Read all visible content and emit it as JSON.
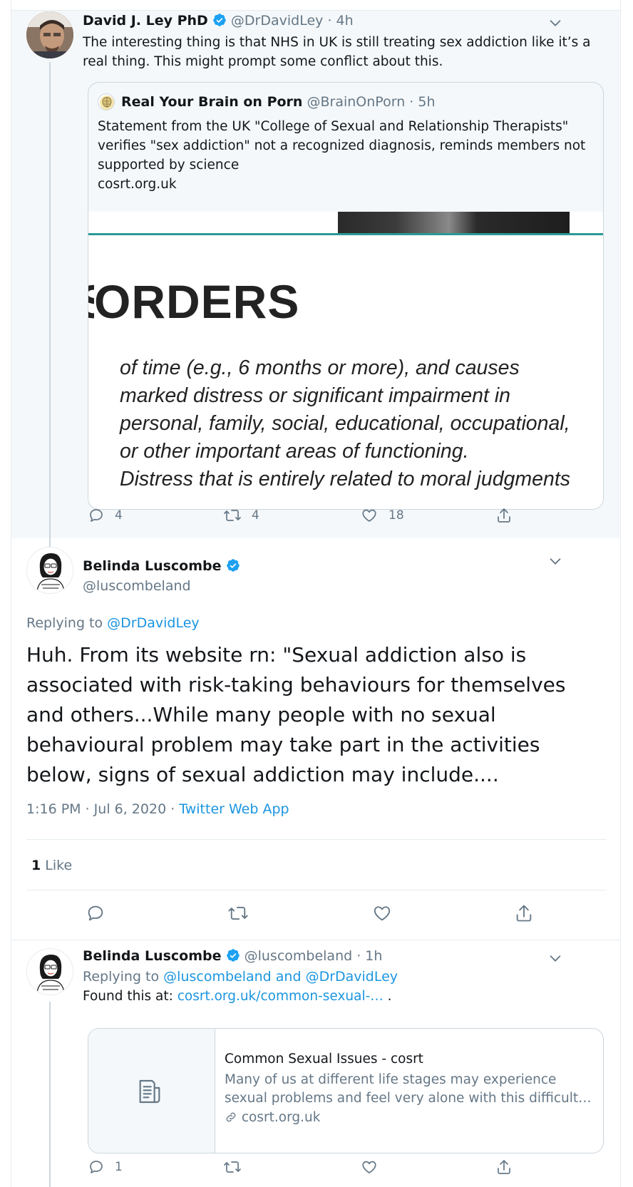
{
  "tweet1": {
    "author": "David J. Ley PhD",
    "handle": "@DrDavidLey",
    "time": "· 4h",
    "text": "The interesting thing is that NHS in UK is still treating sex addiction like it’s a real thing. This might prompt some conflict about this.",
    "quote": {
      "author": "Real Your Brain on Porn",
      "handle": "@BrainOnPorn",
      "time": "· 5h",
      "text": "Statement from the UK \"College of Sexual and Relationship Therapists\" verifies \"sex addiction\" not a recognized diagnosis, reminds members not supported by science",
      "link": "cosrt.org.uk",
      "image_heading": "ORDERS",
      "image_lines": [
        "of time (e.g., 6 months or more), and causes",
        "marked distress or significant impairment in",
        "personal, family, social, educational, occupational,",
        "or other important areas of functioning.",
        "Distress that is entirely related to moral judgments"
      ]
    },
    "replies": "4",
    "retweets": "4",
    "likes": "18"
  },
  "tweet2": {
    "author": "Belinda Luscombe",
    "handle": "@luscombeland",
    "replying_prefix": "Replying to",
    "replying_to": "@DrDavidLey",
    "text": "Huh. From its website rn: \"Sexual addiction also is associated with risk-taking behaviours for themselves and others...While many people with no sexual behavioural problem may take part in the activities below, signs of sexual addiction may include....",
    "timestamp": "1:16 PM · Jul 6, 2020 · ",
    "source": "Twitter Web App",
    "like_count": "1",
    "like_label": " Like"
  },
  "tweet3": {
    "author": "Belinda Luscombe",
    "handle": "@luscombeland",
    "time": "· 1h",
    "replying_prefix": "Replying to",
    "replying_to": "@luscombeland and @DrDavidLey",
    "text_prefix": "Found this at:",
    "text_link": "cosrt.org.uk/common-sexual-…",
    "text_suffix": ".",
    "card": {
      "title": "Common Sexual Issues - cosrt",
      "description": "Many of us at different life stages may experience sexual problems and feel very alone with this difficult…",
      "domain": "cosrt.org.uk"
    },
    "replies": "1"
  },
  "icons": {
    "verified_color": "#1da1f2",
    "accent": "#1b95e0",
    "muted": "#657786"
  }
}
